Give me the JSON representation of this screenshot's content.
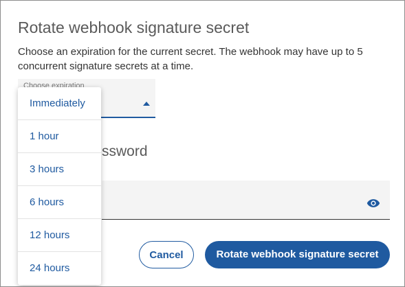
{
  "dialog": {
    "title": "Rotate webhook signature secret",
    "description": "Choose an expiration for the current secret. The webhook may have up to 5 concurrent signature secrets at a time."
  },
  "expiration": {
    "label": "Choose expiration",
    "options": [
      "Immediately",
      "1 hour",
      "3 hours",
      "6 hours",
      "12 hours",
      "24 hours"
    ],
    "selected": "Immediately"
  },
  "password": {
    "heading_partial": "ssword"
  },
  "buttons": {
    "cancel": "Cancel",
    "rotate": "Rotate webhook signature secret"
  },
  "colors": {
    "accent": "#1f5aa0",
    "field_background": "#f4f4f4"
  },
  "icons": {
    "password_visibility": "eye-icon",
    "select_caret": "caret-up-icon"
  }
}
